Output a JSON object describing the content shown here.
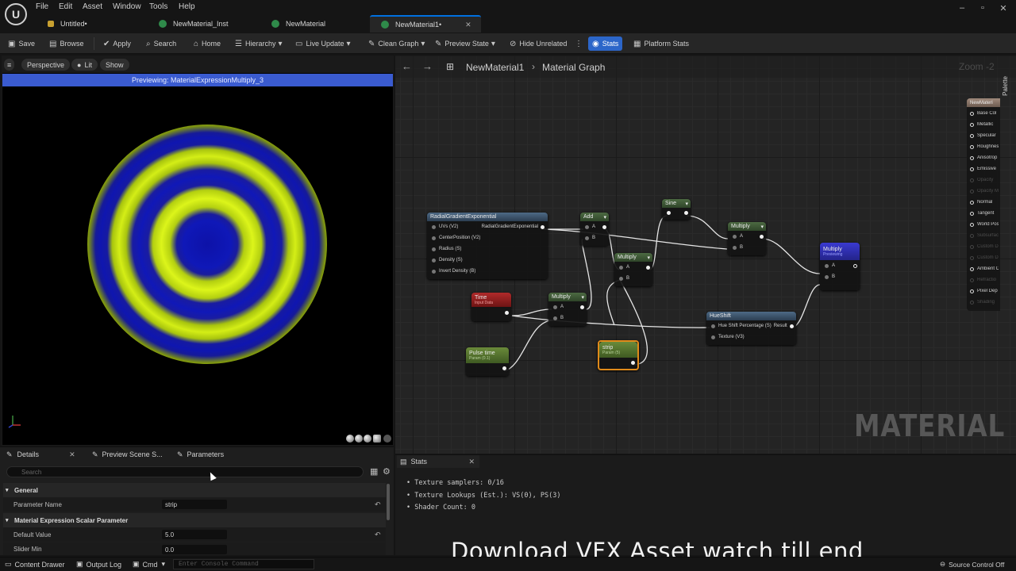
{
  "menu": [
    "File",
    "Edit",
    "Asset",
    "Window",
    "Tools",
    "Help"
  ],
  "tabs": [
    {
      "label": "Untitled•",
      "icon": "material-icon-orange"
    },
    {
      "label": "NewMaterial_Inst",
      "icon": "material-instance-icon"
    },
    {
      "label": "NewMaterial",
      "icon": "material-icon"
    },
    {
      "label": "NewMaterial1•",
      "icon": "material-icon",
      "active": true
    }
  ],
  "toolbar": {
    "save": "Save",
    "browse": "Browse",
    "apply": "Apply",
    "search": "Search",
    "home": "Home",
    "hierarchy": "Hierarchy",
    "live_update": "Live Update",
    "clean_graph": "Clean Graph",
    "preview_state": "Preview State",
    "hide_unrelated": "Hide Unrelated",
    "stats": "Stats",
    "platform_stats": "Platform Stats"
  },
  "viewport": {
    "perspective": "Perspective",
    "lit": "Lit",
    "show": "Show",
    "banner": "Previewing: MaterialExpressionMultiply_3"
  },
  "details": {
    "tabs": [
      "Details",
      "Preview Scene S...",
      "Parameters"
    ],
    "search_placeholder": "Search",
    "section_general": "General",
    "param_name_label": "Parameter Name",
    "param_name_value": "strip",
    "section_scalar": "Material Expression Scalar Parameter",
    "default_value_label": "Default Value",
    "default_value": "5.0",
    "slider_min_label": "Slider Min",
    "slider_min_value": "0.0"
  },
  "graph": {
    "breadcrumb_asset": "NewMaterial1",
    "breadcrumb_graph": "Material Graph",
    "zoom": "Zoom -2",
    "palette": "Palette",
    "watermark": "MATERIAL",
    "nodes": {
      "radial": {
        "title": "RadialGradientExponential",
        "inputs": [
          "UVs (V2)",
          "CenterPosition (V2)",
          "Radius (S)",
          "Density (S)",
          "Invert Density (B)"
        ],
        "output": "RadialGradientExponential"
      },
      "add": {
        "title": "Add",
        "a": "A",
        "b": "B"
      },
      "sine": {
        "title": "Sine"
      },
      "multiply1": {
        "title": "Multiply",
        "a": "A",
        "b": "B"
      },
      "multiply2": {
        "title": "Multiply",
        "a": "A",
        "b": "B"
      },
      "multiply3": {
        "title": "Multiply",
        "a": "A",
        "b": "B"
      },
      "multiply_final": {
        "title": "Multiply",
        "sub": "Previewing",
        "a": "A",
        "b": "B"
      },
      "time": {
        "title": "Time",
        "sub": "Input Data"
      },
      "pulse": {
        "title": "Pulse time",
        "sub": "Param (0.1)"
      },
      "strip": {
        "title": "strip",
        "sub": "Param (5)"
      },
      "hueshift": {
        "title": "HueShift",
        "inputs": [
          "Hue Shift Percentage (S)",
          "Texture (V3)"
        ],
        "output": "Result"
      }
    },
    "result_node": {
      "title": "NewMateri",
      "pins": [
        {
          "label": "Base Col",
          "dim": false
        },
        {
          "label": "Metallic",
          "dim": false
        },
        {
          "label": "Specular",
          "dim": false
        },
        {
          "label": "Roughnes",
          "dim": false
        },
        {
          "label": "Anisotrop",
          "dim": false
        },
        {
          "label": "Emissive",
          "dim": false
        },
        {
          "label": "Opacity",
          "dim": true
        },
        {
          "label": "Opacity M",
          "dim": true
        },
        {
          "label": "Normal",
          "dim": false
        },
        {
          "label": "Tangent",
          "dim": false
        },
        {
          "label": "World Pos",
          "dim": false
        },
        {
          "label": "Subsurfac",
          "dim": true
        },
        {
          "label": "Custom Da",
          "dim": true
        },
        {
          "label": "Custom Da",
          "dim": true
        },
        {
          "label": "Ambient O",
          "dim": false
        },
        {
          "label": "Refractio",
          "dim": true
        },
        {
          "label": "Pixel Dep",
          "dim": false
        },
        {
          "label": "Shading",
          "dim": true
        }
      ]
    }
  },
  "stats": {
    "tab": "Stats",
    "lines": [
      "Texture samplers: 0/16",
      "Texture Lookups (Est.): VS(0), PS(3)",
      "Shader Count: 0"
    ]
  },
  "overlay": "Download VFX Asset watch till end",
  "statusbar": {
    "content_drawer": "Content Drawer",
    "output_log": "Output Log",
    "cmd": "Cmd",
    "console_placeholder": "Enter Console Command",
    "source_control": "Source Control Off"
  },
  "colors": {
    "accent": "#2c66c9",
    "banner": "#3a5bd0",
    "ring_yellow": "#dcf51a",
    "ring_blue": "#1018b8"
  }
}
